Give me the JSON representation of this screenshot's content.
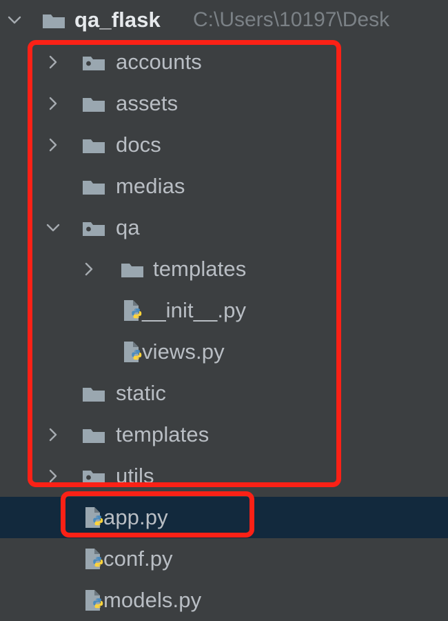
{
  "theme": {
    "background": "#3c3f41",
    "selection_background": "#12293d",
    "label_color": "#b9bec4",
    "path_color": "#7b8186",
    "annotation_color": "#fb2116",
    "folder_color": "#9aa7b0",
    "file_doc_color": "#9aa7b0",
    "python_blue": "#4b8bbe",
    "python_yellow": "#ffd43b"
  },
  "project_root": {
    "name": "qa_flask",
    "path": "C:\\Users\\10197\\Desk",
    "icon": "folder-icon",
    "twisty": "chevron-down-icon",
    "expanded": true
  },
  "tree": [
    {
      "name": "accounts",
      "icon": "folder-source-root-icon",
      "twisty": "chevron-right-icon",
      "depth": 1,
      "type": "folder",
      "selected": false
    },
    {
      "name": "assets",
      "icon": "folder-icon",
      "twisty": "chevron-right-icon",
      "depth": 1,
      "type": "folder",
      "selected": false
    },
    {
      "name": "docs",
      "icon": "folder-icon",
      "twisty": "chevron-right-icon",
      "depth": 1,
      "type": "folder",
      "selected": false
    },
    {
      "name": "medias",
      "icon": "folder-icon",
      "twisty": "none",
      "depth": 1,
      "type": "folder",
      "selected": false
    },
    {
      "name": "qa",
      "icon": "folder-source-root-icon",
      "twisty": "chevron-down-icon",
      "depth": 1,
      "type": "folder",
      "selected": false
    },
    {
      "name": "templates",
      "icon": "folder-icon",
      "twisty": "chevron-right-icon",
      "depth": 2,
      "type": "folder",
      "selected": false
    },
    {
      "name": "__init__.py",
      "icon": "python-file-icon",
      "twisty": "none",
      "depth": 2,
      "type": "file",
      "selected": false
    },
    {
      "name": "views.py",
      "icon": "python-file-icon",
      "twisty": "none",
      "depth": 2,
      "type": "file",
      "selected": false
    },
    {
      "name": "static",
      "icon": "folder-icon",
      "twisty": "none",
      "depth": 1,
      "type": "folder",
      "selected": false
    },
    {
      "name": "templates",
      "icon": "folder-icon",
      "twisty": "chevron-right-icon",
      "depth": 1,
      "type": "folder",
      "selected": false
    },
    {
      "name": "utils",
      "icon": "folder-source-root-icon",
      "twisty": "chevron-right-icon",
      "depth": 1,
      "type": "folder",
      "selected": false
    },
    {
      "name": "app.py",
      "icon": "python-file-icon",
      "twisty": "none",
      "depth": 1,
      "type": "file",
      "selected": true
    },
    {
      "name": "conf.py",
      "icon": "python-file-icon",
      "twisty": "none",
      "depth": 1,
      "type": "file",
      "selected": false
    },
    {
      "name": "models.py",
      "icon": "python-file-icon",
      "twisty": "none",
      "depth": 1,
      "type": "file",
      "selected": false
    }
  ],
  "annotations": [
    {
      "name": "folders-highlight-box",
      "shape": "rounded-rectangle"
    },
    {
      "name": "app-py-highlight-box",
      "shape": "rounded-rectangle"
    }
  ]
}
